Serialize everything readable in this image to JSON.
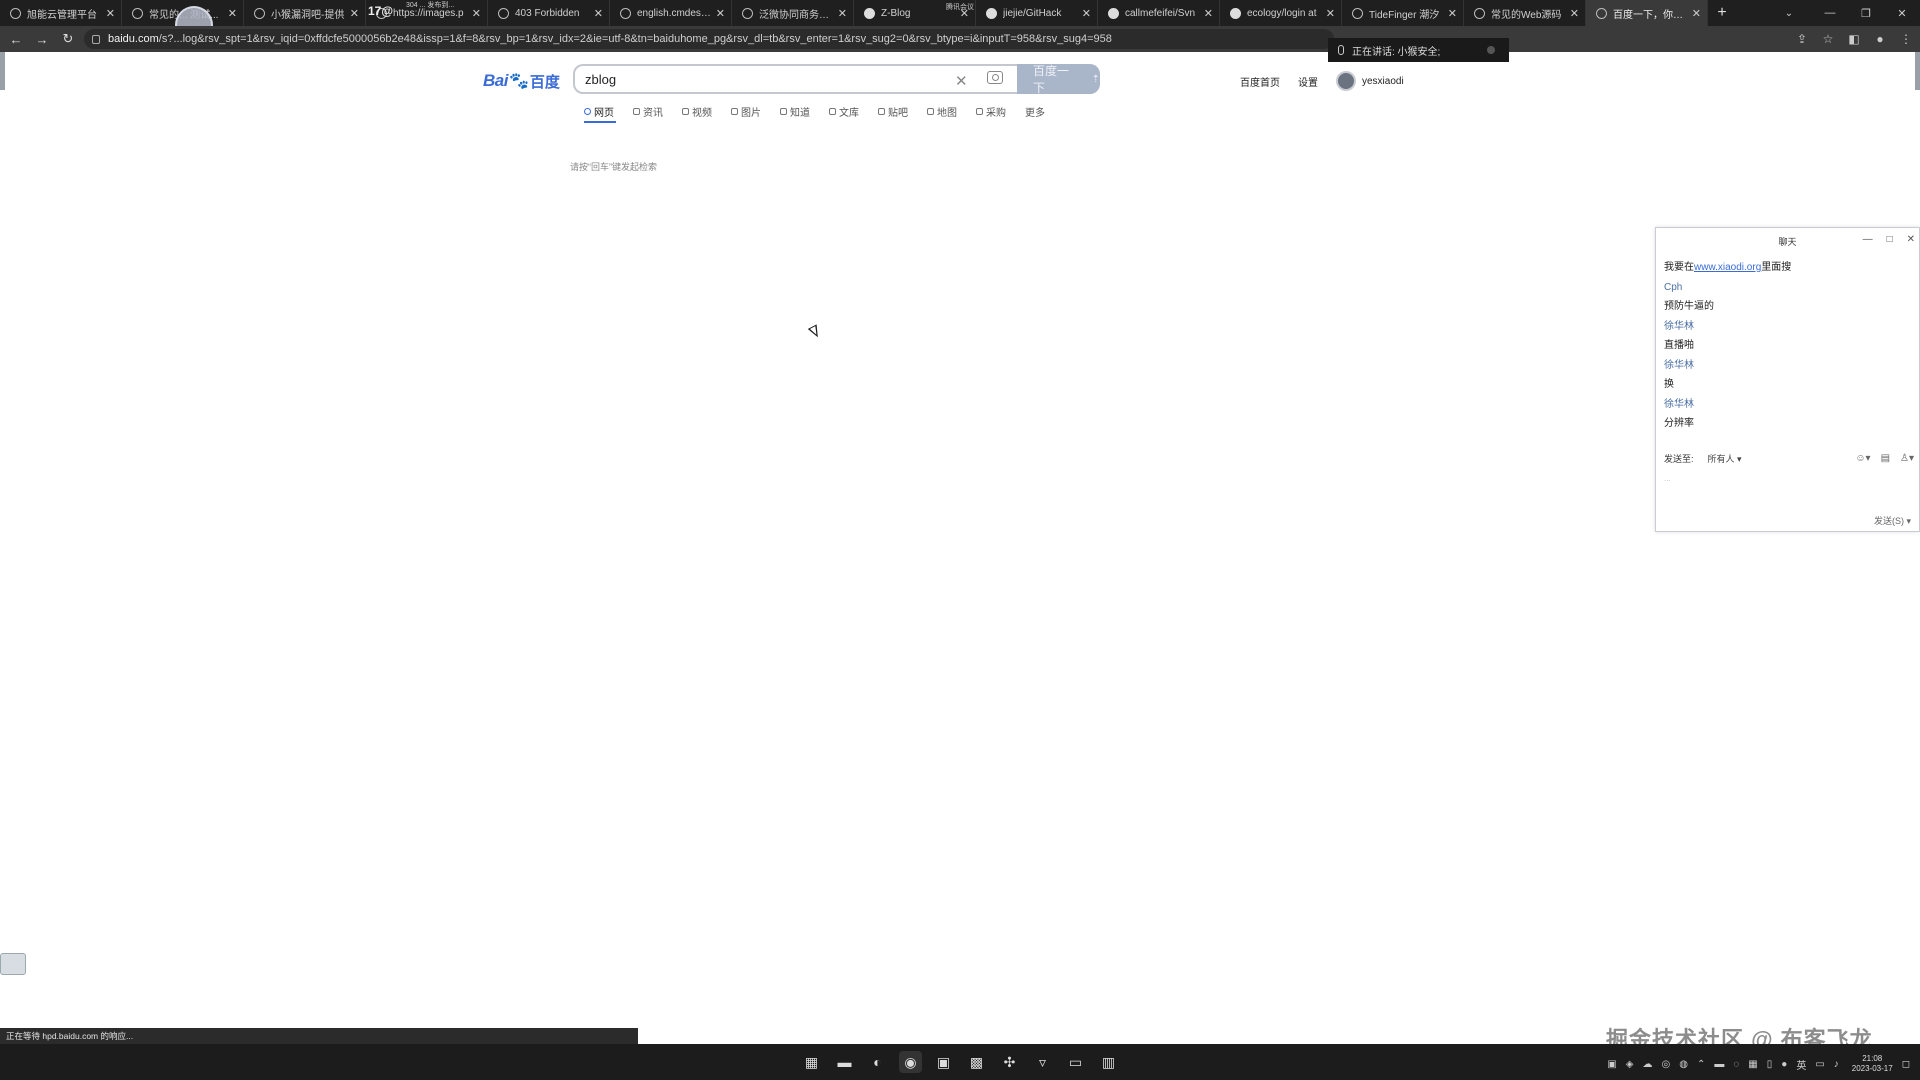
{
  "browser": {
    "tabs": [
      {
        "title": "旭能云管理平台",
        "icon": "globe-icon",
        "active": false
      },
      {
        "title": "常见的... 测试...",
        "icon": "shield-icon",
        "active": false
      },
      {
        "title": "小猴漏洞吧-提供",
        "icon": "globe-icon",
        "active": false
      },
      {
        "title": "https://images.p",
        "icon": "globe-icon",
        "active": false
      },
      {
        "title": "403 Forbidden",
        "icon": "shield-icon",
        "active": false
      },
      {
        "title": "english.cmdesign",
        "icon": "globe-icon",
        "active": false
      },
      {
        "title": "泛微协同商务系统",
        "icon": "app-icon",
        "active": false
      },
      {
        "title": "Z-Blog",
        "icon": "github-icon",
        "active": false
      },
      {
        "title": "jiejie/GitHack",
        "icon": "github-icon",
        "active": false
      },
      {
        "title": "callmefeifei/Svn",
        "icon": "github-icon",
        "active": false
      },
      {
        "title": "ecology/login at",
        "icon": "github-icon",
        "active": false
      },
      {
        "title": "TideFinger 潮汐",
        "icon": "shield-icon",
        "active": false
      },
      {
        "title": "常见的Web源码",
        "icon": "shield-icon",
        "active": false
      },
      {
        "title": "百度一下，你就知",
        "icon": "baidu-icon",
        "active": true
      }
    ],
    "tab_counter": "17@",
    "tab_counter_sub": "304 ... 发布到...",
    "tab_extra_label": "腾讯会议",
    "url_host": "baidu.com",
    "url_rest": "/s?...log&rsv_spt=1&rsv_iqid=0xffdcfe5000056b2e48&issp=1&f=8&rsv_bp=1&rsv_idx=2&ie=utf-8&tn=baiduhome_pg&rsv_dl=tb&rsv_enter=1&rsv_sug2=0&rsv_btype=i&inputT=958&rsv_sug4=958",
    "meeting_banner": "正在讲话: 小猴安全;"
  },
  "baidu": {
    "logo_bai": "Bai",
    "logo_du": "百度",
    "query": "zblog",
    "search_button": "百度一下",
    "nav_home": "百度首页",
    "nav_settings": "设置",
    "username": "yesxiaodi",
    "tabs": [
      "网页",
      "资讯",
      "视频",
      "图片",
      "知道",
      "文库",
      "贴吧",
      "地图",
      "采购",
      "更多"
    ],
    "hint": "请按“回车”键发起检索"
  },
  "chat": {
    "title": "聊天",
    "messages": [
      {
        "text_pre": "我要在",
        "link": "www.xiaodi.org",
        "text_post": "里面搜",
        "kind": "msg"
      },
      {
        "text": "Cph",
        "kind": "name"
      },
      {
        "text": "预防牛逼的",
        "kind": "msg"
      },
      {
        "text": "徐华林",
        "kind": "name"
      },
      {
        "text": "直播啪",
        "kind": "msg"
      },
      {
        "text": "徐华林",
        "kind": "name"
      },
      {
        "text": "换",
        "kind": "msg"
      },
      {
        "text": "徐华林",
        "kind": "name"
      },
      {
        "text": "分辨率",
        "kind": "msg"
      }
    ],
    "send_to_label": "发送至:",
    "send_to_value": "所有人",
    "input_placeholder": "...",
    "send_button": "发送(S)"
  },
  "statusbar": {
    "text": "正在等待 hpd.baidu.com 的响应..."
  },
  "watermark": "掘金技术社区 @ 布客飞龙",
  "taskbar": {
    "time": "21:08",
    "date": "2023-03-17",
    "ime": "英"
  }
}
